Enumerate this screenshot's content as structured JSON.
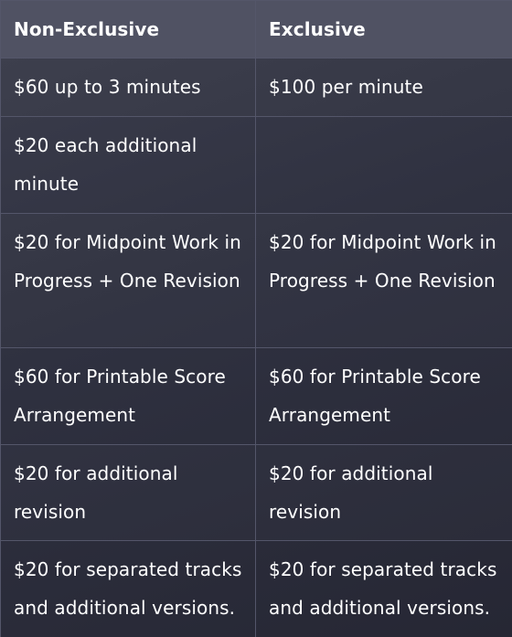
{
  "table": {
    "headers": [
      "Non-Exclusive",
      "Exclusive"
    ],
    "rows": [
      [
        "$60 up to 3 minutes",
        "$100 per minute"
      ],
      [
        "$20 each additional minute",
        ""
      ],
      [
        "$20 for Midpoint Work in Progress + One Revision",
        "$20 for Midpoint Work in Progress + One Revision"
      ],
      [
        "$60 for Printable Score Arrangement",
        "$60 for Printable Score Arrangement"
      ],
      [
        "$20 for additional revision",
        "$20 for additional revision"
      ],
      [
        "$20 for separated tracks and additional versions.",
        "$20 for separated tracks and additional versions."
      ]
    ]
  }
}
